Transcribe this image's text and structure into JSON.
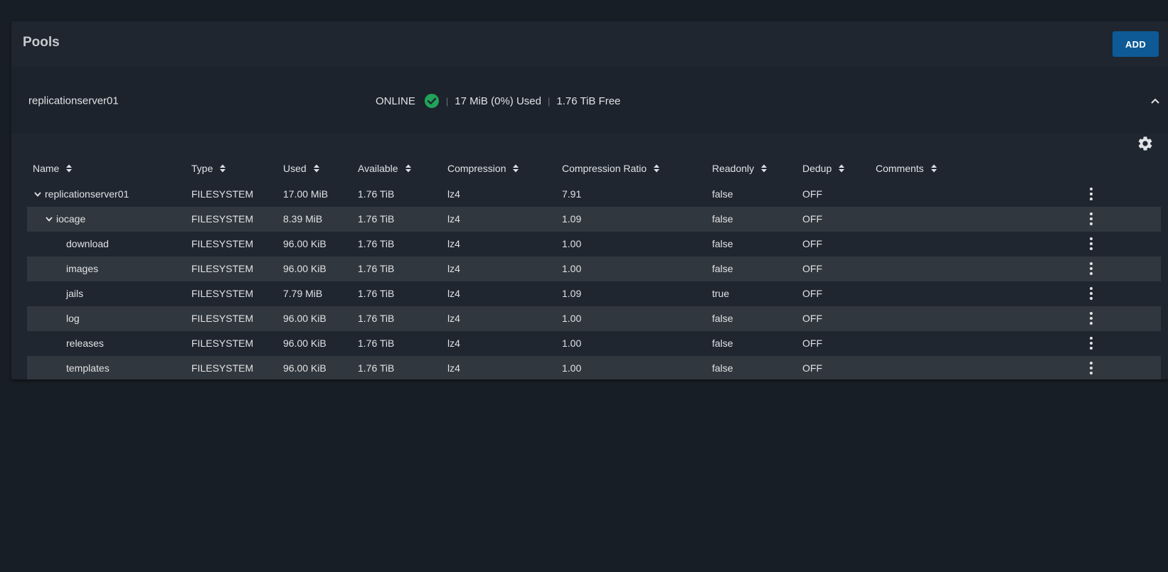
{
  "header": {
    "title": "Pools",
    "add_label": "ADD"
  },
  "pool": {
    "name": "replicationserver01",
    "status": "ONLINE",
    "used": "17 MiB (0%) Used",
    "free": "1.76 TiB Free",
    "status_color": "#21a35a"
  },
  "table": {
    "columns": [
      "Name",
      "Type",
      "Used",
      "Available",
      "Compression",
      "Compression Ratio",
      "Readonly",
      "Dedup",
      "Comments"
    ],
    "rows": [
      {
        "name": "replicationserver01",
        "type": "FILESYSTEM",
        "used": "17.00 MiB",
        "available": "1.76 TiB",
        "compression": "lz4",
        "ratio": "7.91",
        "readonly": "false",
        "dedup": "OFF",
        "comments": ""
      },
      {
        "name": "iocage",
        "type": "FILESYSTEM",
        "used": "8.39 MiB",
        "available": "1.76 TiB",
        "compression": "lz4",
        "ratio": "1.09",
        "readonly": "false",
        "dedup": "OFF",
        "comments": ""
      },
      {
        "name": "download",
        "type": "FILESYSTEM",
        "used": "96.00 KiB",
        "available": "1.76 TiB",
        "compression": "lz4",
        "ratio": "1.00",
        "readonly": "false",
        "dedup": "OFF",
        "comments": ""
      },
      {
        "name": "images",
        "type": "FILESYSTEM",
        "used": "96.00 KiB",
        "available": "1.76 TiB",
        "compression": "lz4",
        "ratio": "1.00",
        "readonly": "false",
        "dedup": "OFF",
        "comments": ""
      },
      {
        "name": "jails",
        "type": "FILESYSTEM",
        "used": "7.79 MiB",
        "available": "1.76 TiB",
        "compression": "lz4",
        "ratio": "1.09",
        "readonly": "true",
        "dedup": "OFF",
        "comments": ""
      },
      {
        "name": "log",
        "type": "FILESYSTEM",
        "used": "96.00 KiB",
        "available": "1.76 TiB",
        "compression": "lz4",
        "ratio": "1.00",
        "readonly": "false",
        "dedup": "OFF",
        "comments": ""
      },
      {
        "name": "releases",
        "type": "FILESYSTEM",
        "used": "96.00 KiB",
        "available": "1.76 TiB",
        "compression": "lz4",
        "ratio": "1.00",
        "readonly": "false",
        "dedup": "OFF",
        "comments": ""
      },
      {
        "name": "templates",
        "type": "FILESYSTEM",
        "used": "96.00 KiB",
        "available": "1.76 TiB",
        "compression": "lz4",
        "ratio": "1.00",
        "readonly": "false",
        "dedup": "OFF",
        "comments": ""
      }
    ]
  }
}
